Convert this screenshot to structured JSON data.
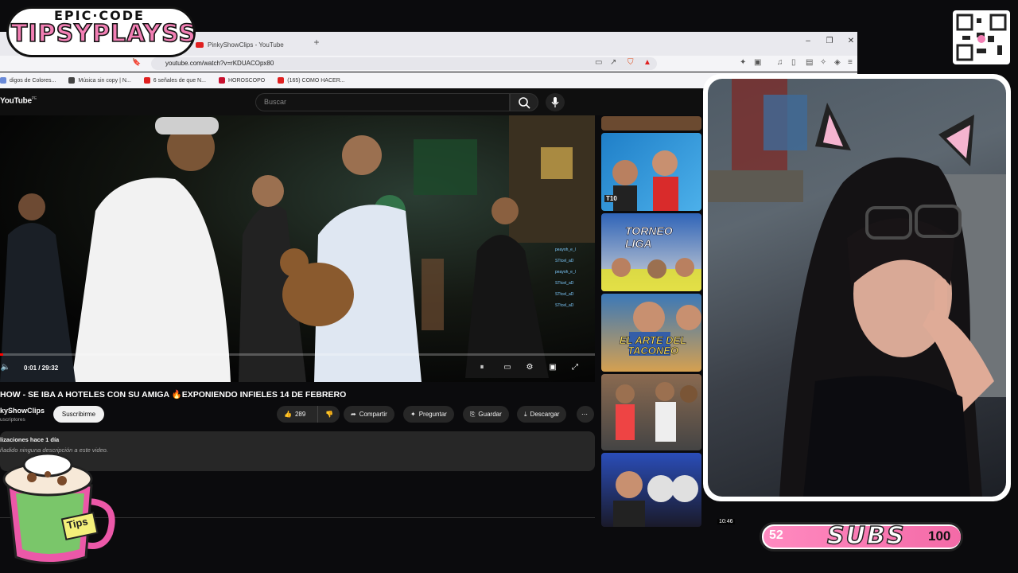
{
  "overlay": {
    "logo_top": "EPIC·CODE",
    "logo_main": "TIPSYPLAYSS",
    "mug_label": "Tips",
    "subs": {
      "current": "52",
      "label": "SUBS",
      "goal": "100",
      "progress": 0.52
    }
  },
  "browser": {
    "tab_title": "PinkyShowClips - YouTube",
    "new_tab": "+",
    "url": "youtube.com/watch?v=rKDUACOpx80",
    "bookmarks": [
      {
        "label": "digos de Colores...",
        "color": "#6a8ad8"
      },
      {
        "label": "Música sin copy | N...",
        "color": "#444"
      },
      {
        "label": "6 señales de que N...",
        "color": "#e02020"
      },
      {
        "label": "HOROSCOPO",
        "color": "#c8102e"
      },
      {
        "label": "(165) COMO HACER...",
        "color": "#e02020"
      }
    ]
  },
  "youtube": {
    "logo": "YouTube",
    "region": "PE",
    "search_placeholder": "Buscar",
    "player": {
      "time": "0:01 / 29:32",
      "progress": 0.0006
    },
    "video_title": "HOW - SE IBA A HOTELES CON SU AMIGA 🔥EXPONIENDO INFIELES 14 DE FEBRERO",
    "channel": {
      "name": "kyShowClips",
      "subs": "uscriptores",
      "subscribe_label": "Suscribirme"
    },
    "actions": {
      "likes": "289",
      "share": "Compartir",
      "ask": "Preguntar",
      "save": "Guardar",
      "download": "Descargar"
    },
    "description": {
      "views": "lizaciones  hace 1 día",
      "text": "ñadido ninguna descripción a este video."
    },
    "sidebar": {
      "thumb_labels": [
        "T10",
        "TORNEO LIGA",
        "EL ARTE DEL TACONEO",
        "",
        "10:46"
      ],
      "colors": [
        "#1f7fc8",
        "#2f64b8",
        "#3a78b8",
        "#8a6a50",
        "#2a4db8"
      ]
    },
    "chat_names": [
      "peayoh_e_l",
      "STtcel_aD",
      "peayoh_e_l",
      "STtcel_aD",
      "STtcel_aD",
      "STtcel_aD"
    ]
  }
}
